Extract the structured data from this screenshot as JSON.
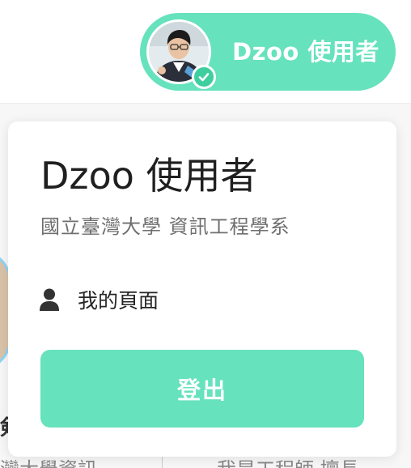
{
  "header": {
    "user_pill": {
      "name": "Dzoo 使用者"
    }
  },
  "dropdown": {
    "user_name": "Dzoo 使用者",
    "department": "國立臺灣大學 資訊工程學系",
    "menu": [
      {
        "label": "我的頁面",
        "icon": "person-icon"
      }
    ],
    "logout_label": "登出"
  },
  "background": {
    "text_1": "剣",
    "text_2": "灣大學資訊",
    "text_3": "我是工程師 擅長"
  },
  "colors": {
    "accent": "#66e2bd",
    "badge": "#3fcf9f",
    "text_primary": "#1f1f1f",
    "text_secondary": "#6f6f6f"
  }
}
